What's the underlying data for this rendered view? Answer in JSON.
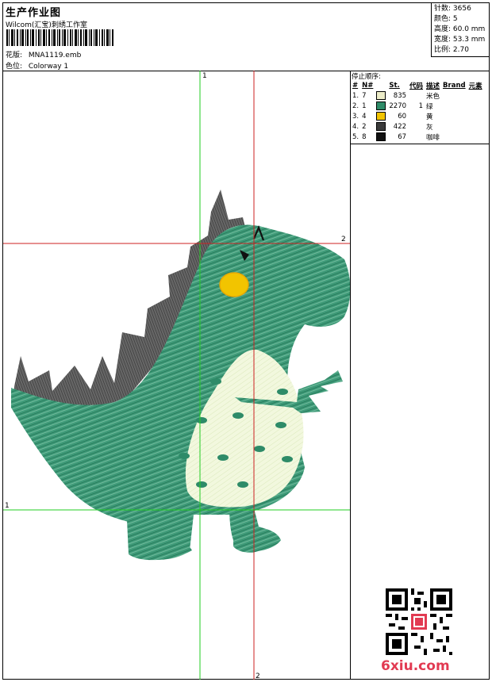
{
  "header": {
    "title": "生产作业图",
    "studio": "Wilcom(汇宝)刺绣工作室",
    "design_label": "花版:",
    "design_file": "MNA1119.emb",
    "colorway_label": "色位:",
    "colorway": "Colorway 1"
  },
  "stats": {
    "stitches": "针数: 3656",
    "colors": "颜色: 5",
    "height": "高度: 60.0 mm",
    "width": "宽度: 53.3 mm",
    "scale": "比例: 2.70"
  },
  "stop_sequence": {
    "heading": "停止顺序:",
    "columns": [
      "#",
      "N#",
      "St.",
      "代码",
      "描述",
      "Brand",
      "元素"
    ],
    "rows": [
      {
        "idx": "1.",
        "needle": "7",
        "color": "#ececc8",
        "stitches": "835",
        "code": "",
        "desc": "米色"
      },
      {
        "idx": "2.",
        "needle": "1",
        "color": "#2e8b68",
        "stitches": "2270",
        "code": "1",
        "desc": "绿"
      },
      {
        "idx": "3.",
        "needle": "4",
        "color": "#f2c400",
        "stitches": "60",
        "code": "",
        "desc": "黄"
      },
      {
        "idx": "4.",
        "needle": "2",
        "color": "#3a3a3a",
        "stitches": "422",
        "code": "",
        "desc": "灰"
      },
      {
        "idx": "5.",
        "needle": "8",
        "color": "#111111",
        "stitches": "67",
        "code": "",
        "desc": "咖啡"
      }
    ]
  },
  "guides": {
    "v1_label": "1",
    "v2_label": "2",
    "h1_label": "1",
    "h2_label": "2",
    "color_a": "#22cc22",
    "color_b": "#cc2222"
  },
  "watermark": {
    "site": "6xiu.com",
    "color": "#e23a52"
  }
}
